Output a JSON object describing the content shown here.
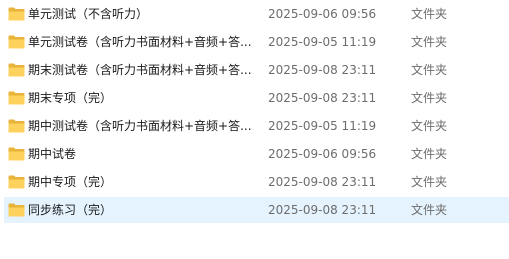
{
  "files": [
    {
      "name": "单元测试（不含听力）",
      "modified": "2025-09-06 09:56",
      "type": "文件夹",
      "icon": "folder-icon",
      "selected": false
    },
    {
      "name": "单元测试卷（含听力书面材料+音频+答...",
      "modified": "2025-09-05 11:19",
      "type": "文件夹",
      "icon": "folder-icon",
      "selected": false
    },
    {
      "name": "期末测试卷（含听力书面材料+音频+答...",
      "modified": "2025-09-08 23:11",
      "type": "文件夹",
      "icon": "folder-icon",
      "selected": false
    },
    {
      "name": "期末专项（完）",
      "modified": "2025-09-08 23:11",
      "type": "文件夹",
      "icon": "folder-icon",
      "selected": false
    },
    {
      "name": "期中测试卷（含听力书面材料+音频+答...",
      "modified": "2025-09-05 11:19",
      "type": "文件夹",
      "icon": "folder-icon",
      "selected": false
    },
    {
      "name": "期中试卷",
      "modified": "2025-09-06 09:56",
      "type": "文件夹",
      "icon": "folder-icon",
      "selected": false
    },
    {
      "name": "期中专项（完）",
      "modified": "2025-09-08 23:11",
      "type": "文件夹",
      "icon": "folder-icon",
      "selected": false
    },
    {
      "name": "同步练习（完）",
      "modified": "2025-09-08 23:11",
      "type": "文件夹",
      "icon": "folder-icon",
      "selected": true
    }
  ],
  "colors": {
    "folder_back": "#e8b43a",
    "folder_front": "#fcd15c",
    "selected_bg": "#e5f3ff"
  }
}
